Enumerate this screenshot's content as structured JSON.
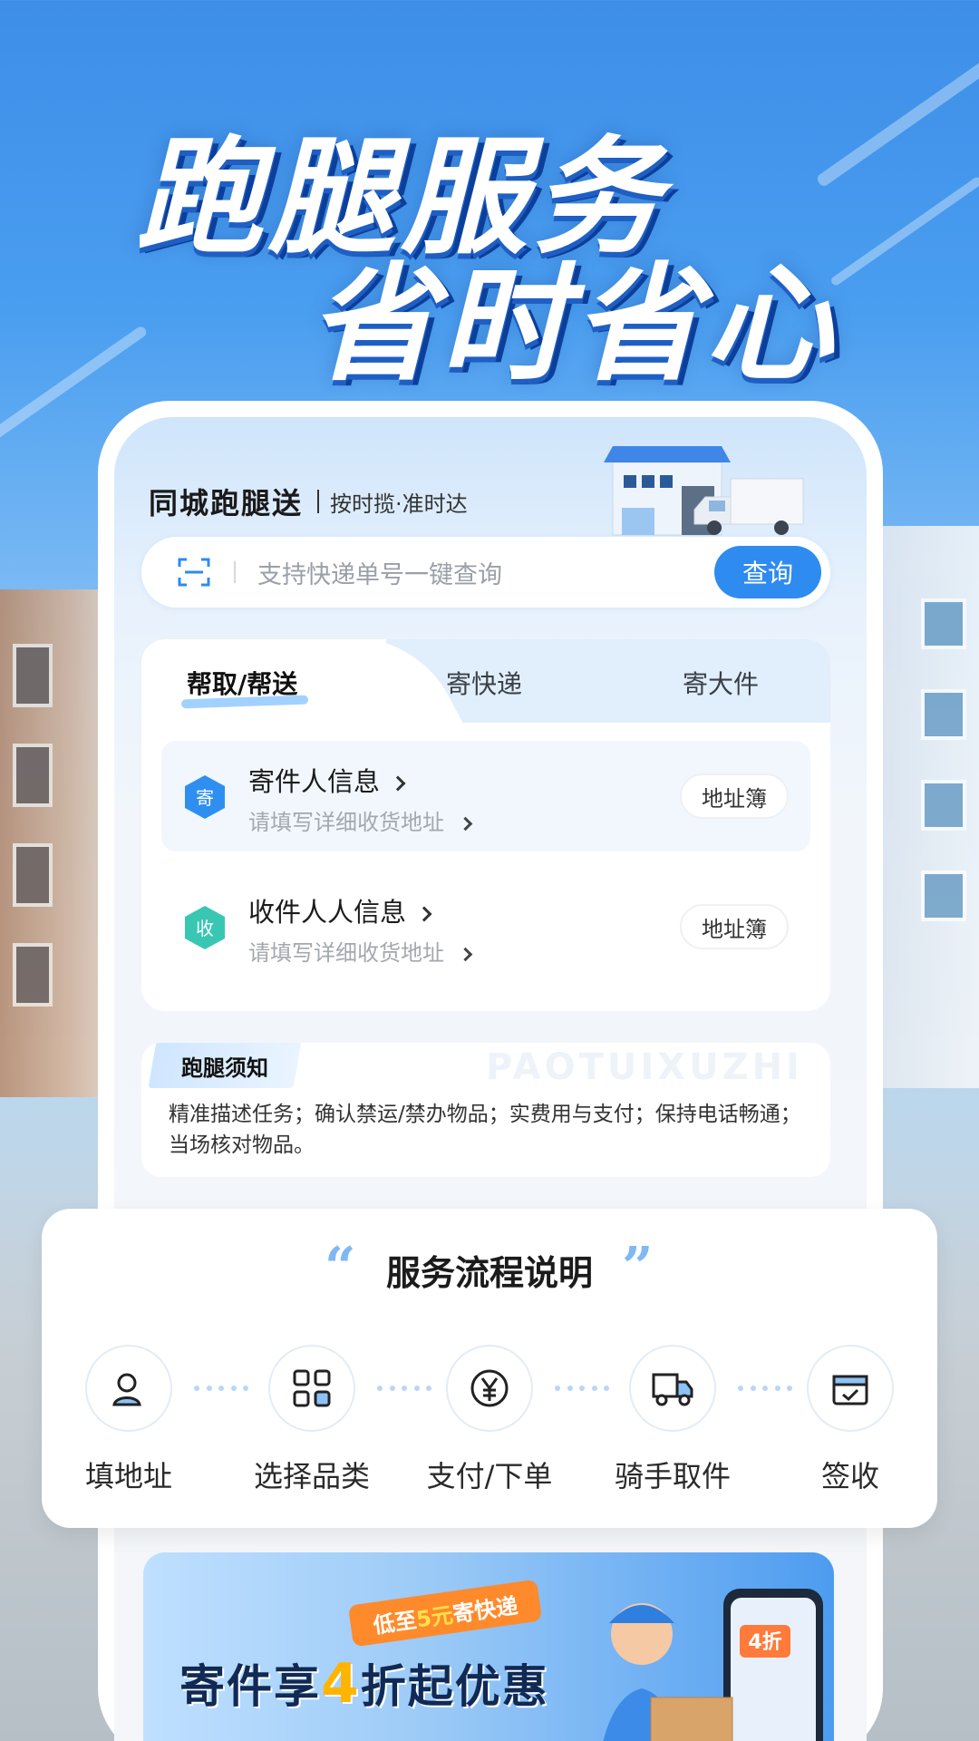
{
  "headline": {
    "line1": "跑腿服务",
    "line2": "省时省心"
  },
  "brand": {
    "title": "同城跑腿送",
    "slogan": "按时揽·准时达"
  },
  "search": {
    "placeholder": "支持快递单号一键查询",
    "button": "查询",
    "icon": "scan-icon"
  },
  "tabs": [
    {
      "label": "帮取/帮送",
      "active": true
    },
    {
      "label": "寄快递",
      "active": false
    },
    {
      "label": "寄大件",
      "active": false
    }
  ],
  "sender": {
    "badge": "寄",
    "title": "寄件人信息",
    "subtitle": "请填写详细收货地址",
    "address_book": "地址簿"
  },
  "receiver": {
    "badge": "收",
    "title": "收件人人信息",
    "subtitle": "请填写详细收货地址",
    "address_book": "地址簿"
  },
  "notice": {
    "title": "跑腿须知",
    "watermark": "PAOTUIXUZHI",
    "text": "精准描述任务；确认禁运/禁办物品；实费用与支付；保持电话畅通；当场核对物品。"
  },
  "process": {
    "title": "服务流程说明",
    "steps": [
      {
        "label": "填地址",
        "icon": "location-person-icon"
      },
      {
        "label": "选择品类",
        "icon": "grid-icon"
      },
      {
        "label": "支付/下单",
        "icon": "yuan-icon"
      },
      {
        "label": "骑手取件",
        "icon": "truck-icon"
      },
      {
        "label": "签收",
        "icon": "sign-box-icon"
      }
    ]
  },
  "promo": {
    "tag_prefix": "低至",
    "tag_amount": "5元",
    "tag_suffix": "寄快递",
    "main_prefix": "寄件享",
    "main_number": "4",
    "main_suffix": "折起优惠",
    "phone_label": "4折"
  },
  "colors": {
    "accent": "#2e8bf0",
    "send_badge": "#2f8ff0",
    "receive_badge": "#39c7b4",
    "promo_tag": "#ff8a2b"
  }
}
